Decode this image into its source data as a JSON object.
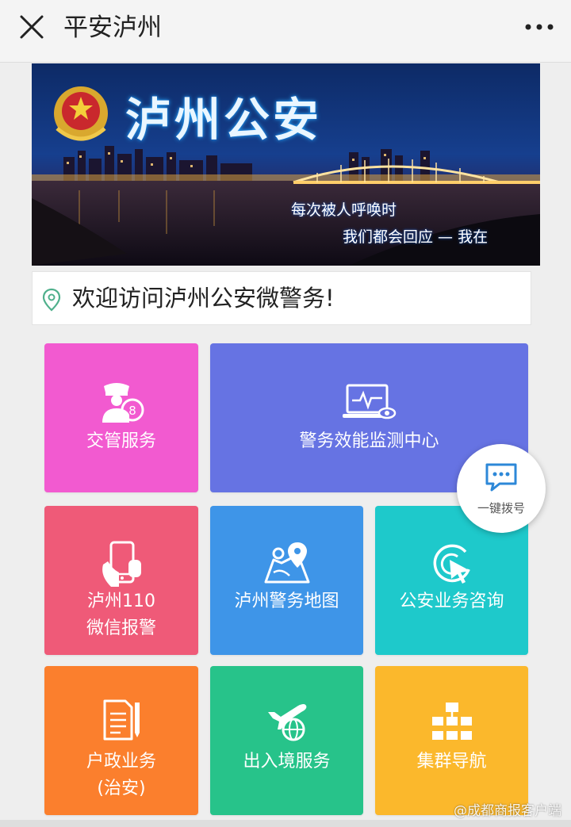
{
  "header": {
    "title": "平安泸州"
  },
  "banner": {
    "heading": "泸州公安",
    "slogan_line1": "每次被人呼唤时",
    "slogan_line2": "我们都会回应 — 我在"
  },
  "welcome": {
    "text": "欢迎访问泸州公安微警务!"
  },
  "tiles": [
    {
      "label_line1": "交管服务",
      "label_line2": "",
      "icon": "traffic-police-icon",
      "color": "#f25ad0"
    },
    {
      "label_line1": "警务效能监测中心",
      "label_line2": "",
      "icon": "monitor-icon",
      "color": "#6673e3"
    },
    {
      "label_line1": "泸州110",
      "label_line2": "微信报警",
      "icon": "phone-icon",
      "color": "#ef5a78"
    },
    {
      "label_line1": "泸州警务地图",
      "label_line2": "",
      "icon": "map-icon",
      "color": "#3e95e8"
    },
    {
      "label_line1": "公安业务咨询",
      "label_line2": "",
      "icon": "cursor-click-icon",
      "color": "#1ec9cb"
    },
    {
      "label_line1": "户政业务",
      "label_line2": "(治安)",
      "icon": "document-icon",
      "color": "#fb7f2d"
    },
    {
      "label_line1": "出入境服务",
      "label_line2": "",
      "icon": "airplane-globe-icon",
      "color": "#27c38a"
    },
    {
      "label_line1": "集群导航",
      "label_line2": "",
      "icon": "hierarchy-icon",
      "color": "#fbb82c"
    }
  ],
  "float_button": {
    "label": "一键拨号",
    "icon": "chat-bubble-icon"
  },
  "watermark": "@成都商报客户端"
}
